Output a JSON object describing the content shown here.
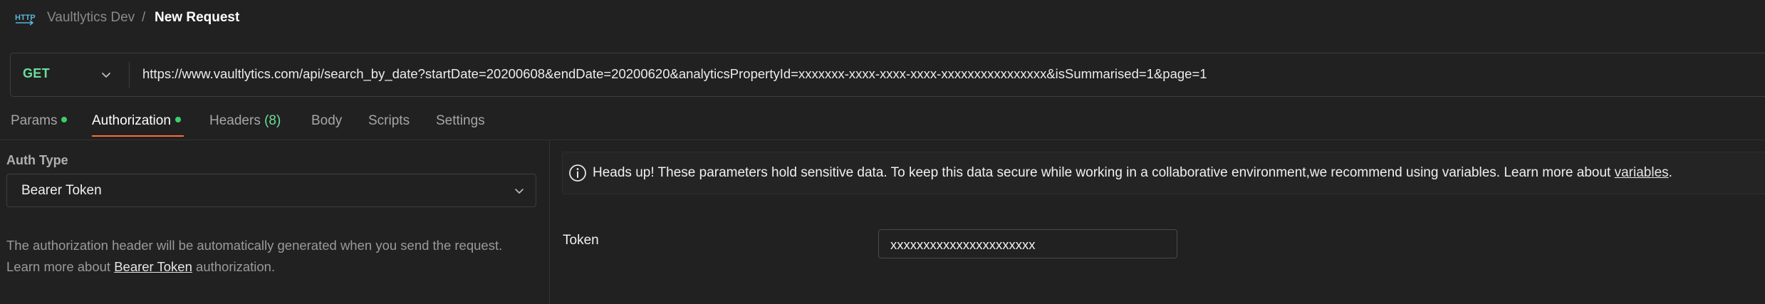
{
  "breadcrumb": {
    "workspace": "Vaultlytics Dev",
    "separator": "/",
    "current": "New Request"
  },
  "request": {
    "method": "GET",
    "url": "https://www.vaultlytics.com/api/search_by_date?startDate=20200608&endDate=20200620&analyticsPropertyId=xxxxxxx-xxxx-xxxx-xxxx-xxxxxxxxxxxxxxxx&isSummarised=1&page=1"
  },
  "tabs": [
    {
      "label": "Params",
      "dot": true,
      "active": false
    },
    {
      "label": "Authorization",
      "dot": true,
      "active": true
    },
    {
      "label": "Headers",
      "count": "(8)",
      "active": false
    },
    {
      "label": "Body",
      "active": false
    },
    {
      "label": "Scripts",
      "active": false
    },
    {
      "label": "Settings",
      "active": false
    }
  ],
  "auth": {
    "type_label": "Auth Type",
    "type_value": "Bearer Token",
    "desc_line1": "The authorization header will be automatically generated when you send the request.",
    "desc_line2_prefix": "Learn more about ",
    "desc_link": "Bearer Token",
    "desc_line2_suffix": " authorization."
  },
  "notice": {
    "text": "Heads up! These parameters hold sensitive data. To keep this data secure while working in a collaborative environment,we recommend using variables. Learn more about ",
    "link": "variables",
    "suffix": "."
  },
  "token": {
    "label": "Token",
    "value": "xxxxxxxxxxxxxxxxxxxxxx"
  },
  "colors": {
    "background": "#212121",
    "method_get": "#6bdd9a",
    "status_dot": "#3bcf6a",
    "active_tab_underline": "#ff6c37",
    "http_icon": "#5bb5d8"
  },
  "icons": {
    "request_type": "http-icon",
    "method_dropdown": "chevron-down-icon",
    "auth_dropdown": "chevron-down-icon",
    "notice": "info-icon"
  }
}
